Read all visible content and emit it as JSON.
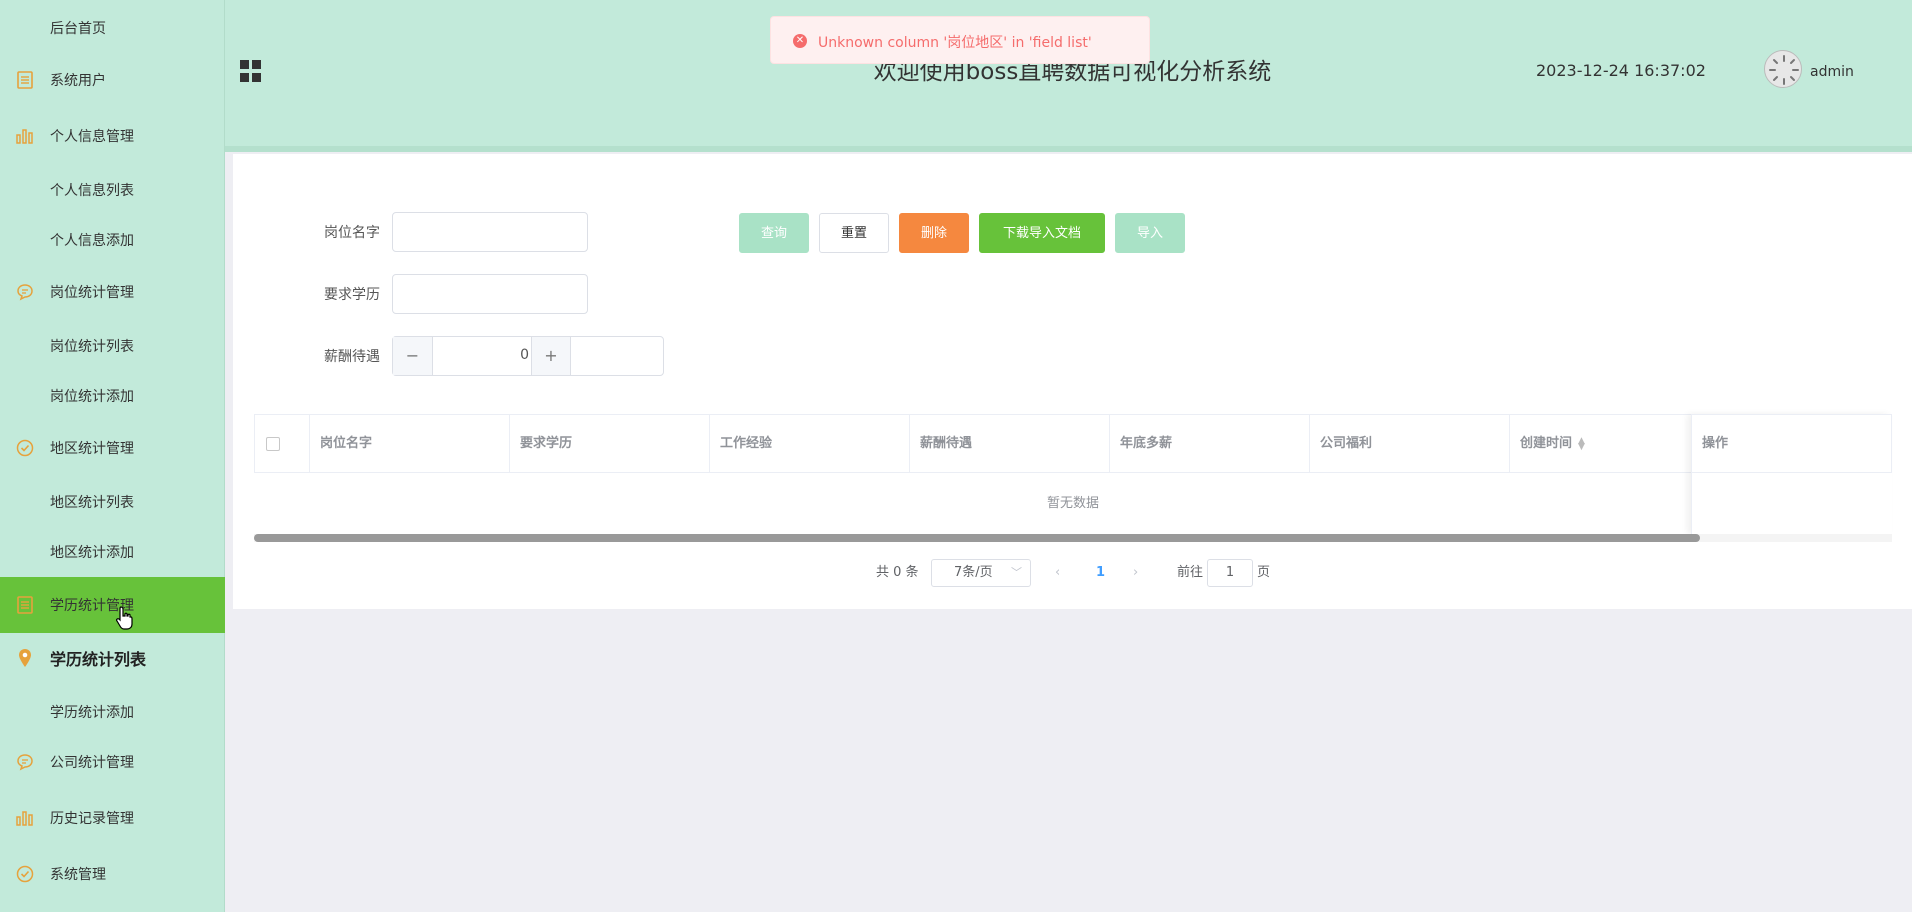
{
  "header": {
    "title": "欢迎使用boss直聘数据可视化分析系统",
    "datetime": "2023-12-24 16:37:02",
    "username": "admin"
  },
  "toast": {
    "message": "Unknown column '岗位地区' in 'field list'",
    "type": "error",
    "color": "#f56c6c"
  },
  "sidebar": {
    "items": [
      {
        "label": "后台首页",
        "icon": ""
      },
      {
        "label": "系统用户",
        "icon": "document-icon"
      },
      {
        "label": "个人信息管理",
        "icon": "bar-chart-icon"
      },
      {
        "label": "个人信息列表",
        "icon": ""
      },
      {
        "label": "个人信息添加",
        "icon": ""
      },
      {
        "label": "岗位统计管理",
        "icon": "chat-icon"
      },
      {
        "label": "岗位统计列表",
        "icon": ""
      },
      {
        "label": "岗位统计添加",
        "icon": ""
      },
      {
        "label": "地区统计管理",
        "icon": "check-circle-icon"
      },
      {
        "label": "地区统计列表",
        "icon": ""
      },
      {
        "label": "地区统计添加",
        "icon": ""
      },
      {
        "label": "学历统计管理",
        "icon": "document-icon",
        "active": true
      },
      {
        "label": "学历统计列表",
        "icon": "location-pin-icon"
      },
      {
        "label": "学历统计添加",
        "icon": ""
      },
      {
        "label": "公司统计管理",
        "icon": "chat-icon"
      },
      {
        "label": "历史记录管理",
        "icon": "bar-chart-icon"
      },
      {
        "label": "系统管理",
        "icon": "check-circle-icon"
      }
    ],
    "active_color": "#67c23a",
    "icon_color": "#e6a23c"
  },
  "form": {
    "job_name_label": "岗位名字",
    "education_label": "要求学历",
    "salary_label": "薪酬待遇",
    "salary_value": "0",
    "minus": "−",
    "plus": "+"
  },
  "buttons": {
    "query": "查询",
    "reset": "重置",
    "delete": "删除",
    "download": "下载导入文档",
    "import": "导入"
  },
  "table": {
    "columns": [
      "岗位名字",
      "要求学历",
      "工作经验",
      "薪酬待遇",
      "年底多薪",
      "公司福利",
      "创建时间",
      "操作"
    ],
    "empty_text": "暂无数据"
  },
  "pagination": {
    "total": "共 0 条",
    "page_size": "7条/页",
    "current_page": "1",
    "goto_label": "前往",
    "goto_value": "1",
    "page_suffix": "页"
  }
}
